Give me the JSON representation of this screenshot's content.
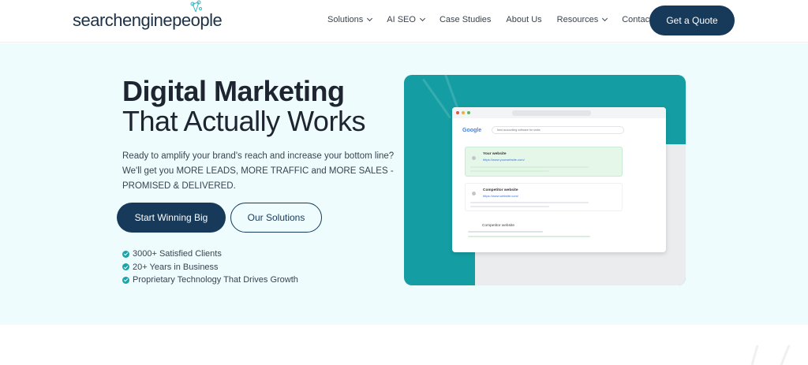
{
  "logo": {
    "text_a": "searchengine",
    "text_b": "pe",
    "text_c": "ple"
  },
  "nav": {
    "items": [
      {
        "label": "Solutions",
        "has_caret": true
      },
      {
        "label": "AI SEO",
        "has_caret": true
      },
      {
        "label": "Case Studies",
        "has_caret": false
      },
      {
        "label": "About Us",
        "has_caret": false
      },
      {
        "label": "Resources",
        "has_caret": true
      },
      {
        "label": "Contact Us",
        "has_caret": false
      }
    ],
    "cta": "Get a Quote"
  },
  "hero": {
    "title_bold": "Digital Marketing",
    "title_regular": "That Actually Works",
    "subtitle": "Ready to amplify your brand's reach and increase your bottom line? We'll get you MORE LEADS, MORE TRAFFIC and MORE SALES - PROMISED & DELIVERED.",
    "primary_button": "Start Winning Big",
    "secondary_button": "Our Solutions",
    "bullets": [
      "3000+ Satisfied Clients",
      "20+ Years in Business",
      "Proprietary Technology That Drives Growth"
    ]
  },
  "illustration": {
    "google": "Google",
    "search_query": "best accounting software for smbs",
    "result_1_title": "Your website",
    "result_1_url": "https://www.yourwebsite.com/",
    "result_2_title": "Competitor website",
    "result_2_url": "https://www.website.com/",
    "result_3_title": "Competitor website"
  },
  "colors": {
    "brand_navy": "#17395a",
    "teal": "#149ea3",
    "hero_bg": "#eefcfd"
  }
}
